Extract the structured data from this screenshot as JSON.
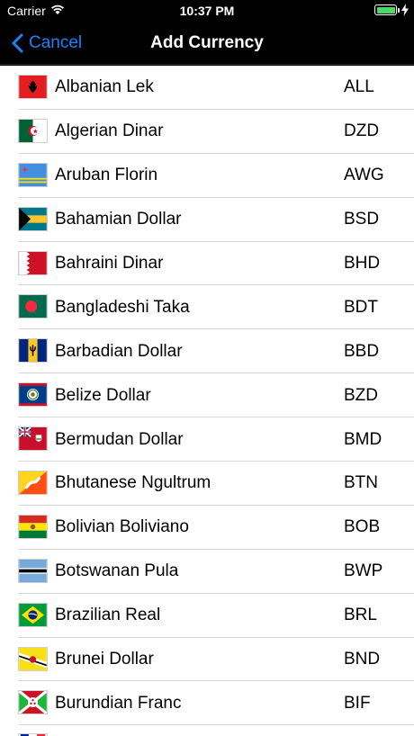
{
  "status_bar": {
    "carrier": "Carrier",
    "time": "10:37 PM",
    "battery_color": "#4cd964"
  },
  "nav": {
    "back_label": "Cancel",
    "title": "Add Currency",
    "accent": "#1a82fb"
  },
  "currencies": [
    {
      "name": "Albanian Lek",
      "code": "ALL",
      "flag": "albania-flag-icon"
    },
    {
      "name": "Algerian Dinar",
      "code": "DZD",
      "flag": "algeria-flag-icon"
    },
    {
      "name": "Aruban Florin",
      "code": "AWG",
      "flag": "aruba-flag-icon"
    },
    {
      "name": "Bahamian Dollar",
      "code": "BSD",
      "flag": "bahamas-flag-icon"
    },
    {
      "name": "Bahraini Dinar",
      "code": "BHD",
      "flag": "bahrain-flag-icon"
    },
    {
      "name": "Bangladeshi Taka",
      "code": "BDT",
      "flag": "bangladesh-flag-icon"
    },
    {
      "name": "Barbadian Dollar",
      "code": "BBD",
      "flag": "barbados-flag-icon"
    },
    {
      "name": "Belize Dollar",
      "code": "BZD",
      "flag": "belize-flag-icon"
    },
    {
      "name": "Bermudan Dollar",
      "code": "BMD",
      "flag": "bermuda-flag-icon"
    },
    {
      "name": "Bhutanese Ngultrum",
      "code": "BTN",
      "flag": "bhutan-flag-icon"
    },
    {
      "name": "Bolivian Boliviano",
      "code": "BOB",
      "flag": "bolivia-flag-icon"
    },
    {
      "name": "Botswanan Pula",
      "code": "BWP",
      "flag": "botswana-flag-icon"
    },
    {
      "name": "Brazilian Real",
      "code": "BRL",
      "flag": "brazil-flag-icon"
    },
    {
      "name": "Brunei Dollar",
      "code": "BND",
      "flag": "brunei-flag-icon"
    },
    {
      "name": "Burundian Franc",
      "code": "BIF",
      "flag": "burundi-flag-icon"
    }
  ]
}
